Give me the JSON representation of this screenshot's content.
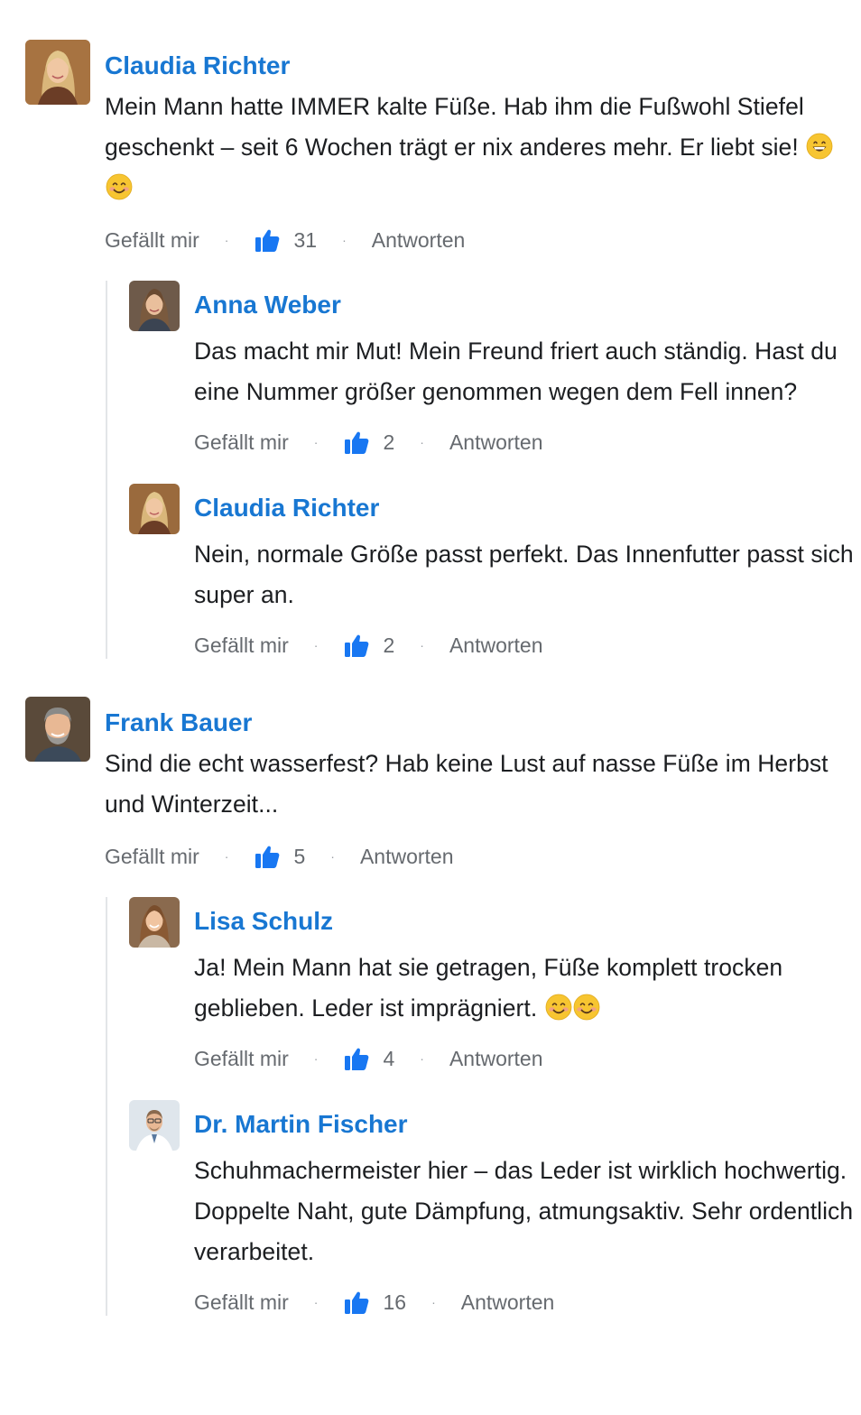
{
  "labels": {
    "like": "Gefällt mir",
    "reply": "Antworten",
    "separator": "·"
  },
  "colors": {
    "author": "#1877d2",
    "like_icon": "#1877f2",
    "meta_text": "#666a6f"
  },
  "comments": [
    {
      "author": "Claudia Richter",
      "avatar": "avatar-claudia",
      "text": "Mein Mann hatte IMMER kalte Füße. Hab ihm die Fußwohl Stiefel geschenkt – seit 6 Wochen trägt er nix anderes mehr. Er liebt sie!",
      "emojis": [
        "grinning-face-emoji",
        "smiling-face-emoji"
      ],
      "likes": "31",
      "replies": [
        {
          "author": "Anna Weber",
          "avatar": "avatar-anna",
          "text": "Das macht mir Mut! Mein Freund friert auch ständig. Hast du eine Nummer größer genommen wegen dem Fell innen?",
          "likes": "2"
        },
        {
          "author": "Claudia Richter",
          "avatar": "avatar-claudia",
          "text": "Nein, normale Größe passt perfekt. Das Innenfutter passt sich super an.",
          "likes": "2"
        }
      ]
    },
    {
      "author": "Frank Bauer",
      "avatar": "avatar-frank",
      "text": "Sind die echt wasserfest? Hab keine Lust auf nasse Füße im Herbst und Winterzeit...",
      "likes": "5",
      "replies": [
        {
          "author": "Lisa Schulz",
          "avatar": "avatar-lisa",
          "text": "Ja! Mein Mann hat sie getragen, Füße komplett trocken geblieben. Leder ist imprägniert.",
          "emojis": [
            "smiling-face-emoji",
            "smiling-face-emoji"
          ],
          "likes": "4"
        },
        {
          "author": "Dr. Martin Fischer",
          "avatar": "avatar-martin",
          "text": "Schuhmachermeister hier – das Leder ist wirklich hochwertig. Doppelte Naht, gute Dämpfung, atmungsaktiv. Sehr ordentlich verarbeitet.",
          "likes": "16"
        }
      ]
    }
  ]
}
